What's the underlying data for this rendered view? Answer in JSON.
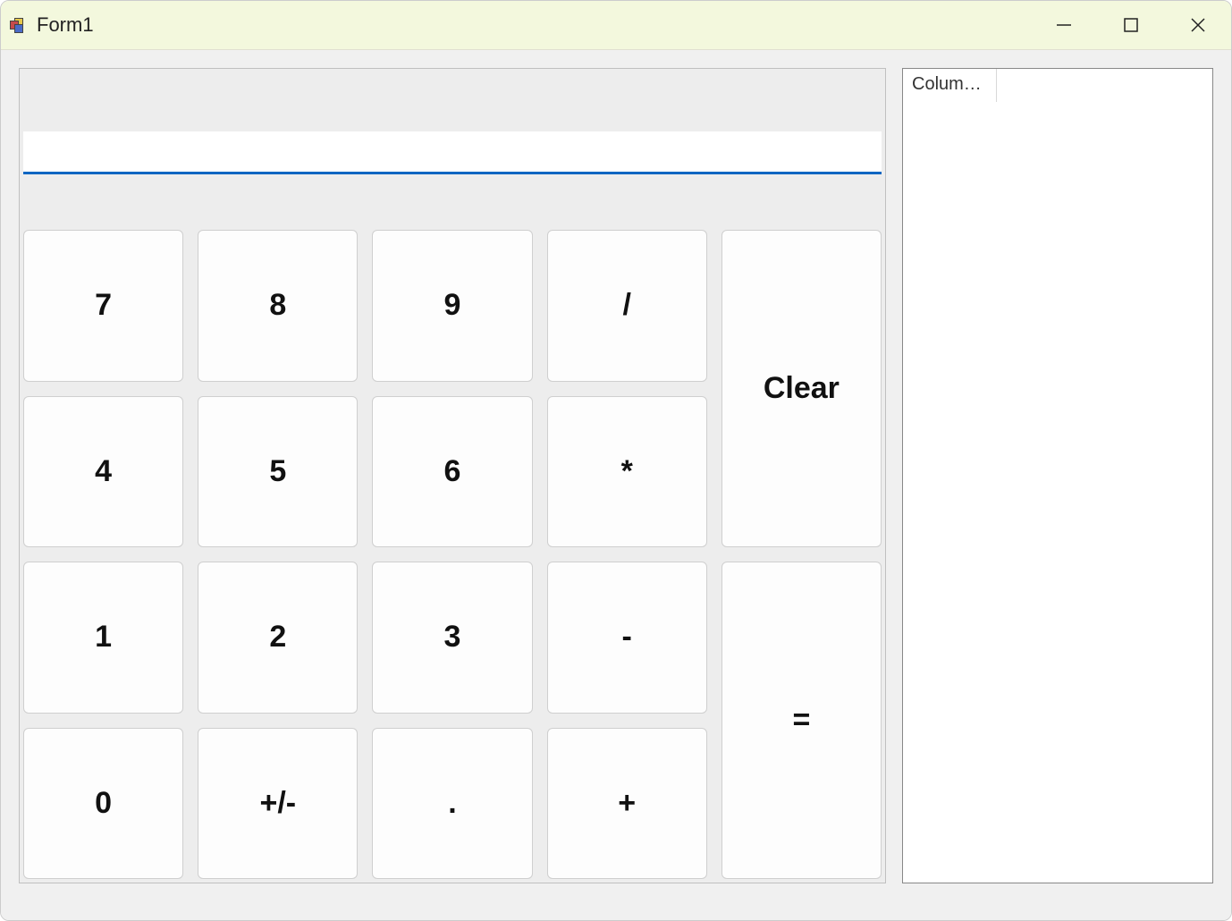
{
  "window": {
    "title": "Form1"
  },
  "display": {
    "value": ""
  },
  "buttons": {
    "b7": "7",
    "b8": "8",
    "b9": "9",
    "div": "/",
    "clear": "Clear",
    "b4": "4",
    "b5": "5",
    "b6": "6",
    "mul": "*",
    "b1": "1",
    "b2": "2",
    "b3": "3",
    "sub": "-",
    "eq": "=",
    "b0": "0",
    "sign": "+/-",
    "dot": ".",
    "add": "+"
  },
  "listview": {
    "column1": "Column..."
  }
}
